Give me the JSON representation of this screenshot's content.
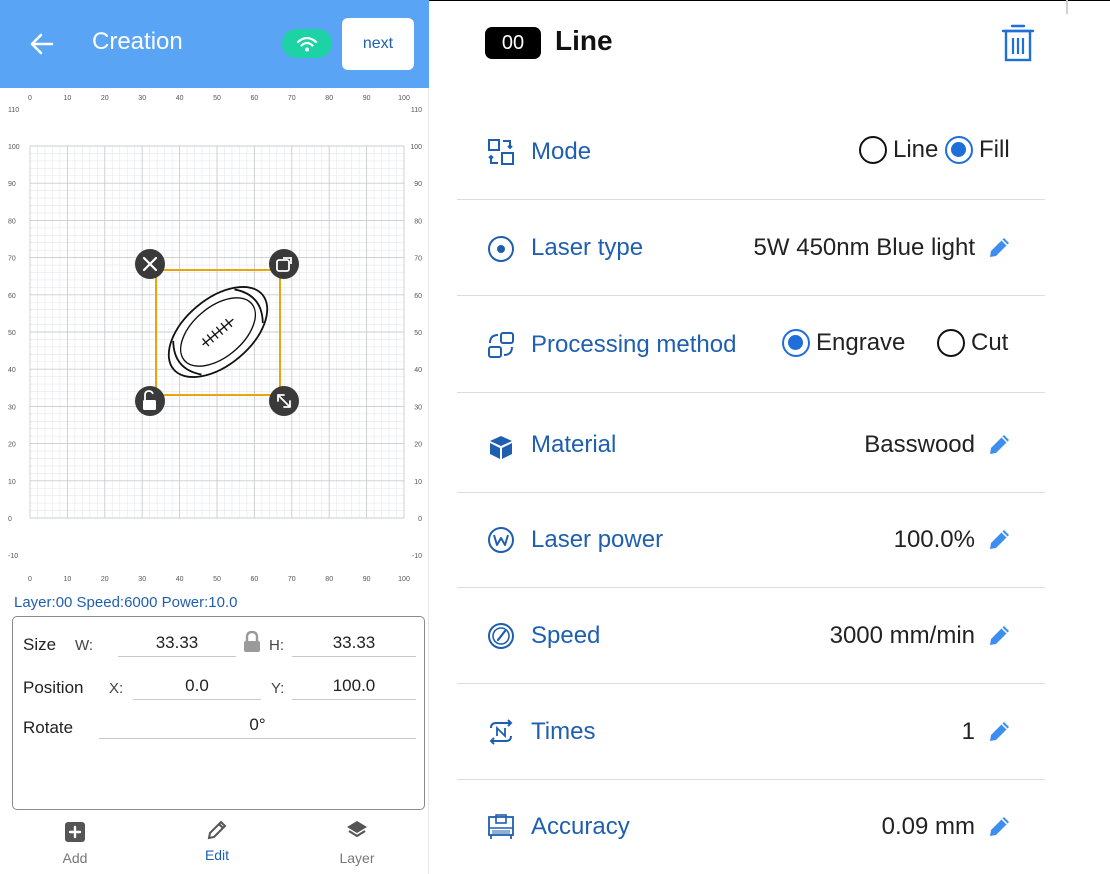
{
  "header": {
    "title": "Creation",
    "next_label": "next"
  },
  "canvas": {
    "x_ticks": [
      "0",
      "10",
      "20",
      "30",
      "40",
      "50",
      "60",
      "70",
      "80",
      "90",
      "100"
    ],
    "y_ticks": [
      "110",
      "100",
      "90",
      "80",
      "70",
      "60",
      "50",
      "40",
      "30",
      "20",
      "10",
      "0",
      "-10"
    ],
    "object_icon": "football-icon"
  },
  "status_line": "Layer:00  Speed:6000  Power:10.0",
  "props": {
    "size_label": "Size",
    "w_label": "W:",
    "w_value": "33.33",
    "h_label": "H:",
    "h_value": "33.33",
    "position_label": "Position",
    "x_label": "X:",
    "x_value": "0.0",
    "y_label": "Y:",
    "y_value": "100.0",
    "rotate_label": "Rotate",
    "rotate_value": "0°"
  },
  "bottom_nav": [
    {
      "label": "Add",
      "icon": "add-icon"
    },
    {
      "label": "Edit",
      "icon": "pencil-icon",
      "active": true
    },
    {
      "label": "Layer",
      "icon": "layers-icon"
    }
  ],
  "layer": {
    "badge": "00",
    "title": "Line"
  },
  "settings": {
    "mode": {
      "label": "Mode",
      "options": [
        "Line",
        "Fill"
      ],
      "selected": "Fill"
    },
    "laser_type": {
      "label": "Laser type",
      "value": "5W 450nm Blue light"
    },
    "processing": {
      "label": "Processing method",
      "options": [
        "Engrave",
        "Cut"
      ],
      "selected": "Engrave"
    },
    "material": {
      "label": "Material",
      "value": "Basswood"
    },
    "laser_power": {
      "label": "Laser power",
      "value": "100.0%"
    },
    "speed": {
      "label": "Speed",
      "value": "3000 mm/min"
    },
    "times": {
      "label": "Times",
      "value": "1"
    },
    "accuracy": {
      "label": "Accuracy",
      "value": "0.09 mm"
    }
  },
  "colors": {
    "header_bg": "#5aa4f6",
    "accent": "#1e6fd9",
    "label_blue": "#1f5fb0",
    "wifi_pill": "#1dd3a6",
    "selection": "#e8a50e"
  }
}
